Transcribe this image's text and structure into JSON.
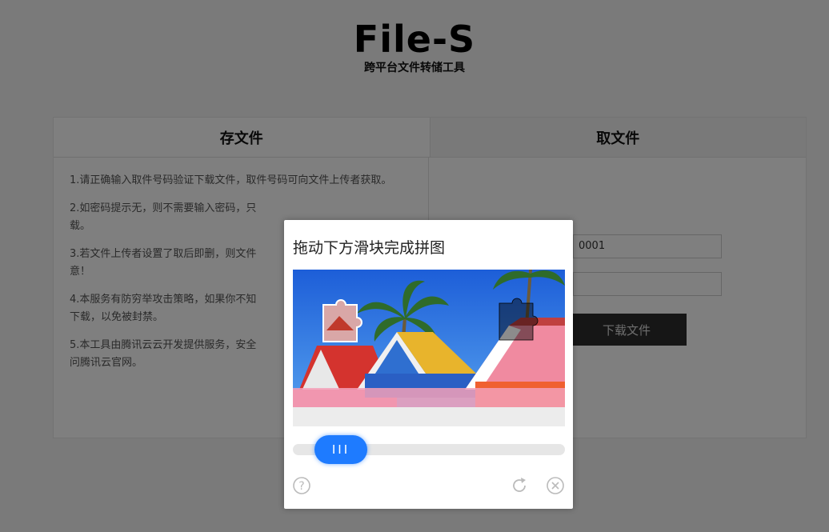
{
  "logo": {
    "title": "File-S",
    "subtitle": "跨平台文件转储工具"
  },
  "tabs": {
    "store": "存文件",
    "retrieve": "取文件"
  },
  "tips": [
    "1.请正确输入取件号码验证下载文件，取件号码可向文件上传者获取。",
    "2.如密码提示无，则不需要输入密码，只",
    "3.若文件上传者设置了取后即删，则文件",
    "4.本服务有防穷举攻击策略，如果你不知",
    "5.本工具由腾讯云云开发提供服务，安全"
  ],
  "tips_cont": [
    "载。",
    "意！",
    "下载，以免被封禁。",
    "问腾讯云官网。"
  ],
  "form": {
    "code_value": "0001",
    "password_value": "",
    "download_label": "下载文件"
  },
  "captcha": {
    "title": "拖动下方滑块完成拼图",
    "knob_label": "III",
    "progress": 0.08,
    "icons": [
      "help-icon",
      "refresh-icon",
      "close-icon"
    ]
  },
  "colors": {
    "accent": "#1e7bff",
    "overlay": "rgba(0,0,0,0.5)",
    "button_dark": "#2d2d2d"
  }
}
